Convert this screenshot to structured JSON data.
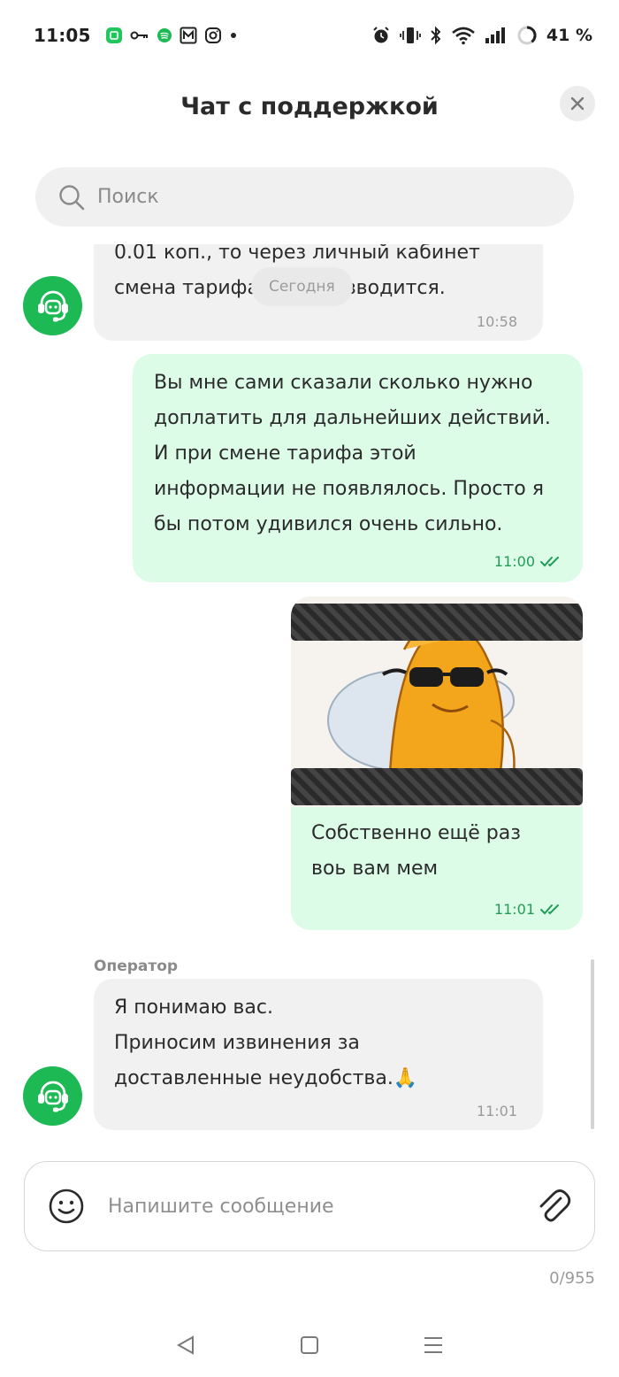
{
  "status_bar": {
    "time": "11:05",
    "battery": "41 %",
    "left_icons": [
      "green-app-icon",
      "key-icon",
      "spotify-icon",
      "m-logo-icon",
      "instagram-icon",
      "dot-icon"
    ],
    "right_icons": [
      "alarm-icon",
      "vibrate-icon",
      "bluetooth-icon",
      "wifi-icon",
      "signal-icon",
      "battery-ring-icon"
    ]
  },
  "header": {
    "title": "Чат с поддержкой"
  },
  "search": {
    "placeholder": "Поиск"
  },
  "chat": {
    "date_chip": "Сегодня",
    "messages": [
      {
        "side": "in",
        "text": "0.01 коп., то через личный кабинет\nсмена тарифа не производится.",
        "time": "10:58"
      },
      {
        "side": "out",
        "text": "Вы мне сами сказали сколько нужно\nдоплатить для дальнейших действий.\nИ при смене тарифа этой\nинформации не появлялось. Просто я\nбы потом удивился очень сильно.",
        "time": "11:00"
      },
      {
        "side": "out",
        "image": "meme-image",
        "text": "Собственно ещё раз\nвоь вам мем",
        "time": "11:01"
      },
      {
        "side": "in",
        "sender": "Оператор",
        "text": "Я понимаю вас.\nПриносим извинения за\nдоставленные неудобства.🙏",
        "time": "11:01"
      }
    ]
  },
  "composer": {
    "placeholder": "Напишите сообщение",
    "counter": "0/955"
  },
  "colors": {
    "accent": "#1db954",
    "outgoing_bubble": "#dcfce8",
    "incoming_bubble": "#f1f1f1",
    "read_check": "#1f9d55"
  }
}
